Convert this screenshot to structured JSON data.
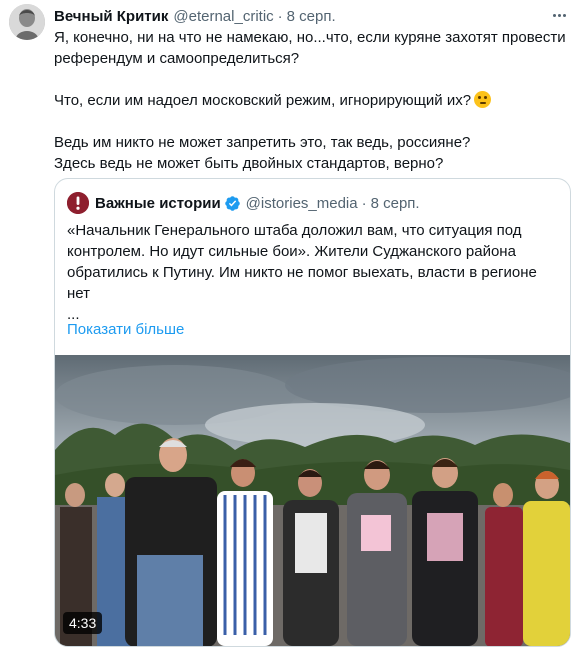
{
  "tweet": {
    "author_name": "Вечный Критик",
    "handle": "@eternal_critic",
    "separator": "·",
    "date": "8 серп.",
    "lines": [
      "Я, конечно, ни на что не намекаю, но...что, если куряне захотят провести",
      "референдум и самоопределиться?",
      "",
      "Что, если им надоел московский режим, игнорирующий их?",
      "",
      "Ведь им никто не может запретить это, так ведь, россияне?",
      "Здесь ведь не может быть двойных стандартов, верно?"
    ],
    "emoji": "thinking-face-emoji"
  },
  "quoted": {
    "author_name": "Важные истории",
    "handle": "@istories_media",
    "separator": "·",
    "date": "8 серп.",
    "lines": [
      "«Начальник Генерального штаба доложил вам, что ситуация под",
      "контролем. Но идут сильные бои». Жители Суджанского района",
      "обратились к Путину. Им никто не помог выехать, власти в регионе",
      "нет",
      "..."
    ],
    "show_more": "Показати більше",
    "video_duration": "4:33"
  },
  "colors": {
    "text_primary": "#0f1419",
    "text_secondary": "#536471",
    "link": "#1d9bf0",
    "border": "#cfd9de",
    "verified": "#1d9bf0",
    "quote_avatar": "#8e1f2e"
  },
  "icons": {
    "more": "more-horizontal-icon",
    "verified": "verified-badge-icon"
  }
}
